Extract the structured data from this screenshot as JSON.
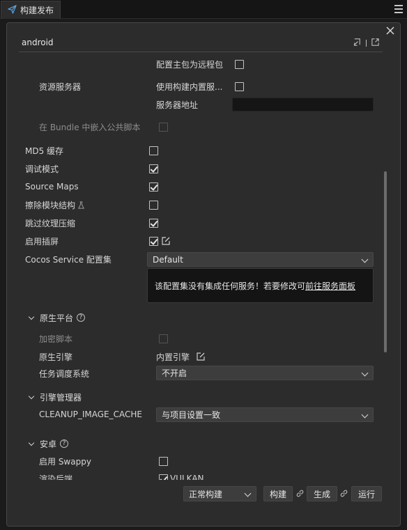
{
  "tab": {
    "title": "构建发布"
  },
  "panel": {
    "header_title": "android"
  },
  "settings": {
    "main_remote": {
      "label": "配置主包为远程包",
      "checked": false
    },
    "asset_server": {
      "label": "资源服务器"
    },
    "use_builtin_server": {
      "label": "使用构建内置服...",
      "checked": false
    },
    "server_address": {
      "label": "服务器地址",
      "value": ""
    },
    "embed_bundle": {
      "label": "在 Bundle 中嵌入公共脚本",
      "checked": false
    },
    "md5": {
      "label": "MD5 缓存",
      "checked": false
    },
    "debug": {
      "label": "调试模式",
      "checked": true
    },
    "source_maps": {
      "label": "Source Maps",
      "checked": true
    },
    "erase_modules": {
      "label": "擦除模块结构",
      "checked": false
    },
    "skip_compress": {
      "label": "跳过纹理压缩",
      "checked": true
    },
    "splash": {
      "label": "启用插屏",
      "checked": true
    },
    "cocos_service": {
      "label": "Cocos Service 配置集",
      "value": "Default"
    },
    "service_info": {
      "text": "该配置集没有集成任何服务！若要修改可",
      "link": "前往服务面板"
    }
  },
  "native": {
    "section": "原生平台",
    "encrypt": {
      "label": "加密脚本",
      "checked": false
    },
    "engine": {
      "label": "原生引擎",
      "value": "内置引擎"
    },
    "scheduler": {
      "label": "任务调度系统",
      "value": "不开启"
    }
  },
  "engine_manager": {
    "section": "引擎管理器",
    "cleanup": {
      "label": "CLEANUP_IMAGE_CACHE",
      "value": "与项目设置一致"
    }
  },
  "android": {
    "section": "安卓",
    "swappy": {
      "label": "启用 Swappy",
      "checked": false
    },
    "render_backend": {
      "label": "渲染后端",
      "option": "VULKAN",
      "checked": true
    }
  },
  "footer": {
    "build_mode": "正常构建",
    "build": "构建",
    "make": "生成",
    "run": "运行"
  }
}
